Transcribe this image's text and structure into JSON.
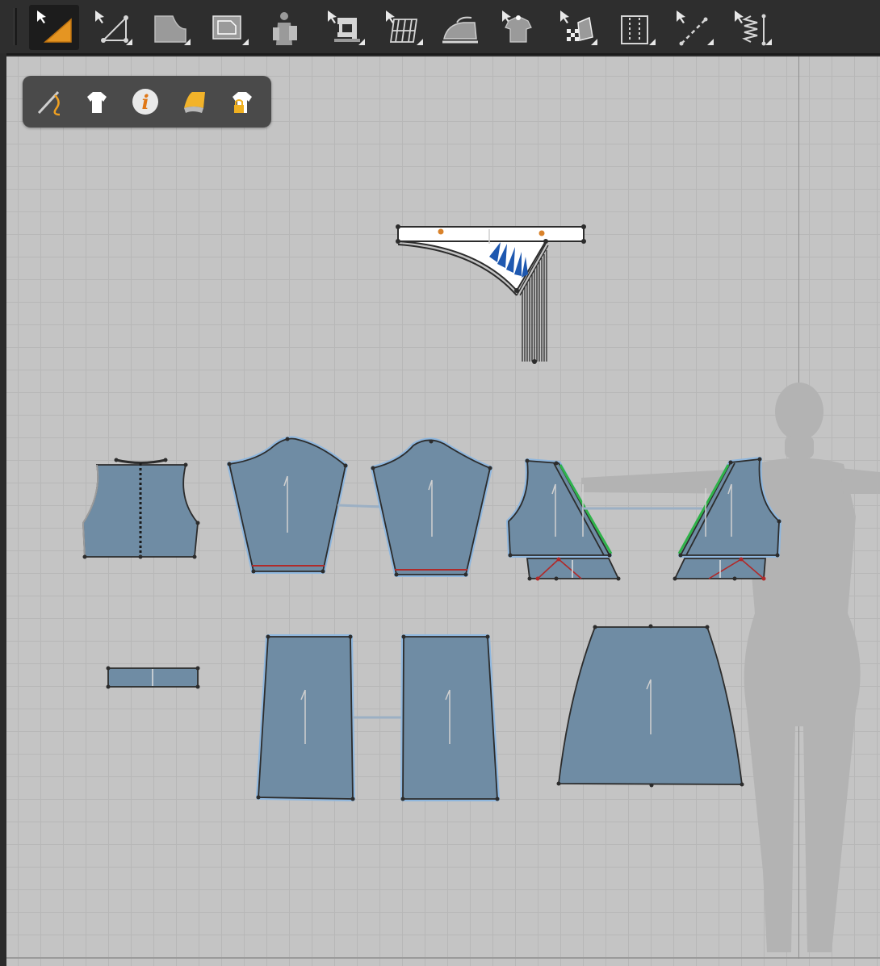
{
  "toolbar": {
    "tools": [
      {
        "id": "edit-pattern",
        "icon": "edit-pattern-icon",
        "active": true
      },
      {
        "id": "edit-point-line",
        "icon": "edit-point-line-icon"
      },
      {
        "id": "polygon",
        "icon": "polygon-icon"
      },
      {
        "id": "rectangle",
        "icon": "rectangle-icon"
      },
      {
        "id": "avatar-arrangement",
        "icon": "avatar-arrangement-icon"
      },
      {
        "id": "segment-sewing",
        "icon": "segment-sewing-icon"
      },
      {
        "id": "edit-mesh",
        "icon": "edit-mesh-icon"
      },
      {
        "id": "iron",
        "icon": "iron-icon"
      },
      {
        "id": "trace",
        "icon": "trace-garment-icon"
      },
      {
        "id": "edit-texture",
        "icon": "edit-texture-icon"
      },
      {
        "id": "fold-line",
        "icon": "fold-line-icon"
      },
      {
        "id": "internal-line",
        "icon": "internal-line-icon"
      },
      {
        "id": "elastic",
        "icon": "elastic-icon"
      }
    ]
  },
  "floating_toolbar": {
    "tools": [
      {
        "id": "needle",
        "icon": "needle-thread-icon"
      },
      {
        "id": "garment",
        "icon": "tshirt-icon"
      },
      {
        "id": "info",
        "icon": "info-icon",
        "label": "i"
      },
      {
        "id": "fabric",
        "icon": "fabric-swatch-icon"
      },
      {
        "id": "lock",
        "icon": "locked-garment-icon"
      }
    ]
  },
  "colors": {
    "pattern_fill": "#6f8ca4",
    "outline": "#2c2c2c",
    "selected_glow": "#8fb7de",
    "seam_red": "#b02a2a",
    "seam_green": "#2fb34a",
    "accent_orange": "#d9822b",
    "texture_blue": "#1e58b0"
  }
}
